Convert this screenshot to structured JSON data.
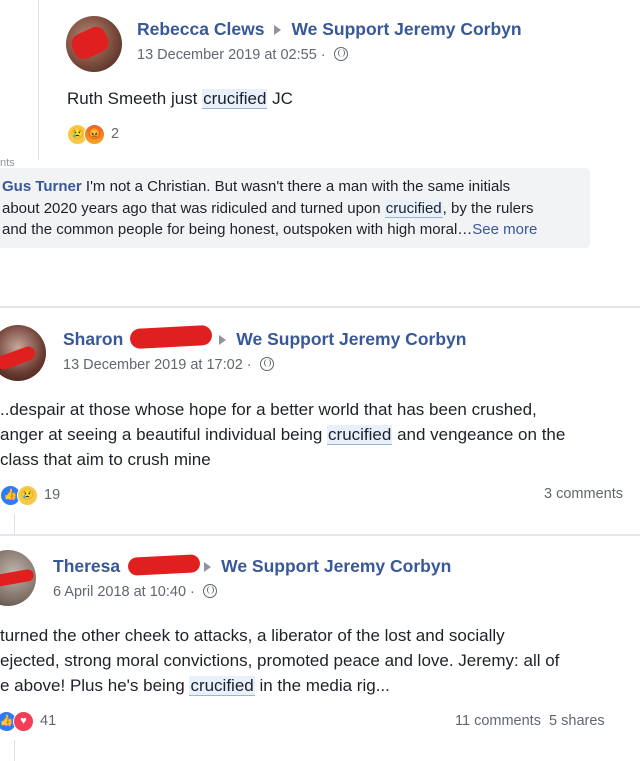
{
  "posts": [
    {
      "author": "Rebecca Clews",
      "group": "We Support Jeremy Corbyn",
      "timestamp": "13 December 2019 at 02:55",
      "text_before": "Ruth Smeeth just ",
      "highlight": "crucified",
      "text_after": " JC",
      "reaction_count": "2",
      "reactions": [
        "sad",
        "angry"
      ]
    },
    {
      "author": "Sharon",
      "group": "We Support Jeremy Corbyn",
      "timestamp": "13 December 2019 at 17:02",
      "line1": "..despair at those whose hope for a better world that has been crushed,",
      "line2_before": "anger at seeing a beautiful individual being ",
      "highlight": "crucified",
      "line2_after": " and vengeance on the",
      "line3": "class that aim to crush mine",
      "reaction_count": "19",
      "reactions": [
        "like",
        "sad"
      ],
      "comments": "3 comments"
    },
    {
      "author": "Theresa",
      "group": "We Support Jeremy Corbyn",
      "timestamp": "6 April 2018 at 10:40",
      "line1": "turned the other cheek to attacks, a liberator of the lost and socially",
      "line2": "ejected, strong moral convictions, promoted peace and love. Jeremy: all of",
      "line3_before": "e above! Plus he's being ",
      "highlight": "crucified",
      "line3_after": " in the media rig...",
      "reaction_count": "41",
      "reactions": [
        "like",
        "love"
      ],
      "comments": "11 comments",
      "shares": "5 shares"
    }
  ],
  "comment": {
    "cut_label": "nts",
    "author": "Gus Turner",
    "line1": " I'm not a Christian. But wasn't there a man with the same initials",
    "line2_before": "about 2020 years ago that was ridiculed and turned upon ",
    "highlight": "crucified",
    "line2_after": ", by the rulers",
    "line3": "and the common people for being honest, outspoken with high moral…",
    "see_more": "See more"
  }
}
